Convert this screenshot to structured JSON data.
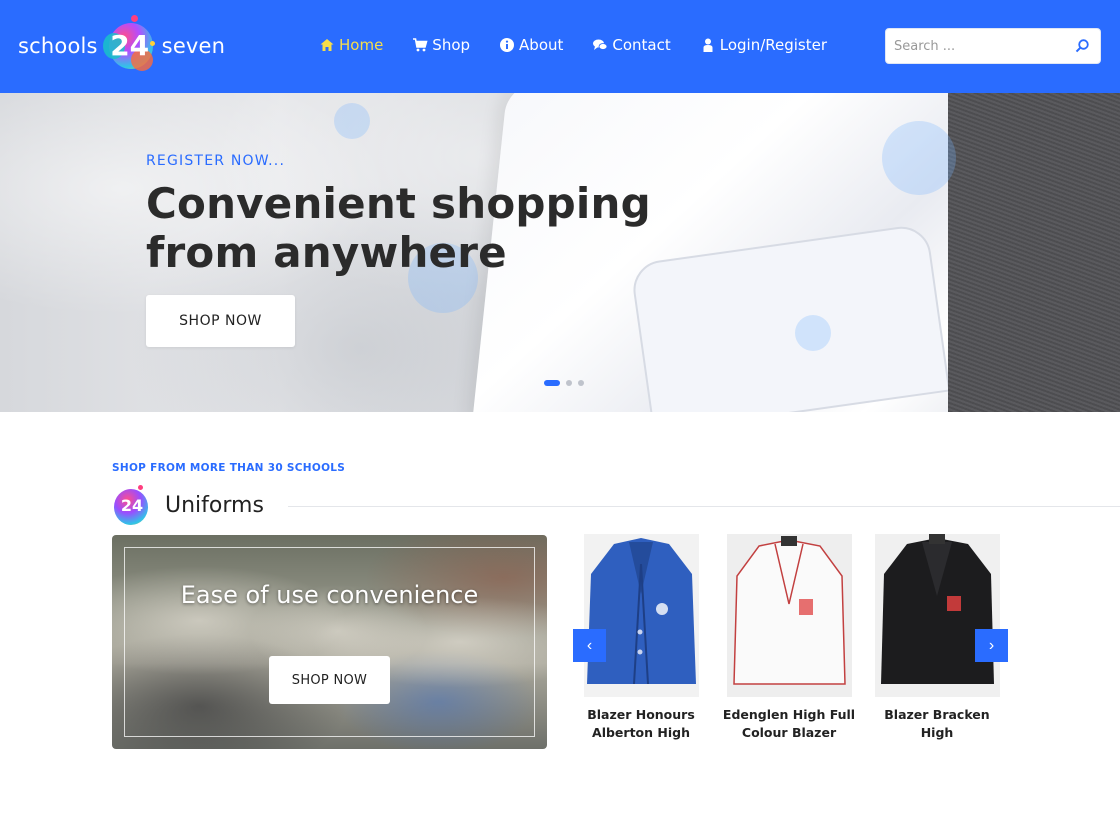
{
  "header": {
    "logo": {
      "left": "schools",
      "number": "24",
      "right": "seven"
    },
    "nav": [
      {
        "label": "Home",
        "icon": "home-icon",
        "active": true
      },
      {
        "label": "Shop",
        "icon": "cart-icon",
        "active": false
      },
      {
        "label": "About",
        "icon": "info-icon",
        "active": false
      },
      {
        "label": "Contact",
        "icon": "chat-icon",
        "active": false
      },
      {
        "label": "Login/Register",
        "icon": "user-icon",
        "active": false
      }
    ],
    "search": {
      "placeholder": "Search ...",
      "value": ""
    }
  },
  "hero": {
    "kicker": "REGISTER NOW...",
    "title_line1": "Convenient shopping",
    "title_line2": "from anywhere",
    "button_label": "SHOP NOW",
    "slides": 3,
    "active_slide": 1
  },
  "uniforms": {
    "kicker": "SHOP FROM MORE THAN 30 SCHOOLS",
    "icon_number": "24",
    "title": "Uniforms",
    "promo": {
      "title": "Ease of use convenience",
      "button_label": "SHOP NOW"
    },
    "products": [
      {
        "name_line1": "Blazer Honours",
        "name_line2": "Alberton High",
        "image": "blue-blazer"
      },
      {
        "name_line1": "Edenglen High Full",
        "name_line2": "Colour Blazer",
        "image": "white-blazer"
      },
      {
        "name_line1": "Blazer Bracken High",
        "name_line2": "",
        "image": "black-blazer"
      }
    ],
    "prev_arrow": "‹",
    "next_arrow": "›"
  },
  "colors": {
    "brand_blue": "#2a6cff",
    "nav_active": "#f7de4a",
    "text_dark": "#222222"
  }
}
